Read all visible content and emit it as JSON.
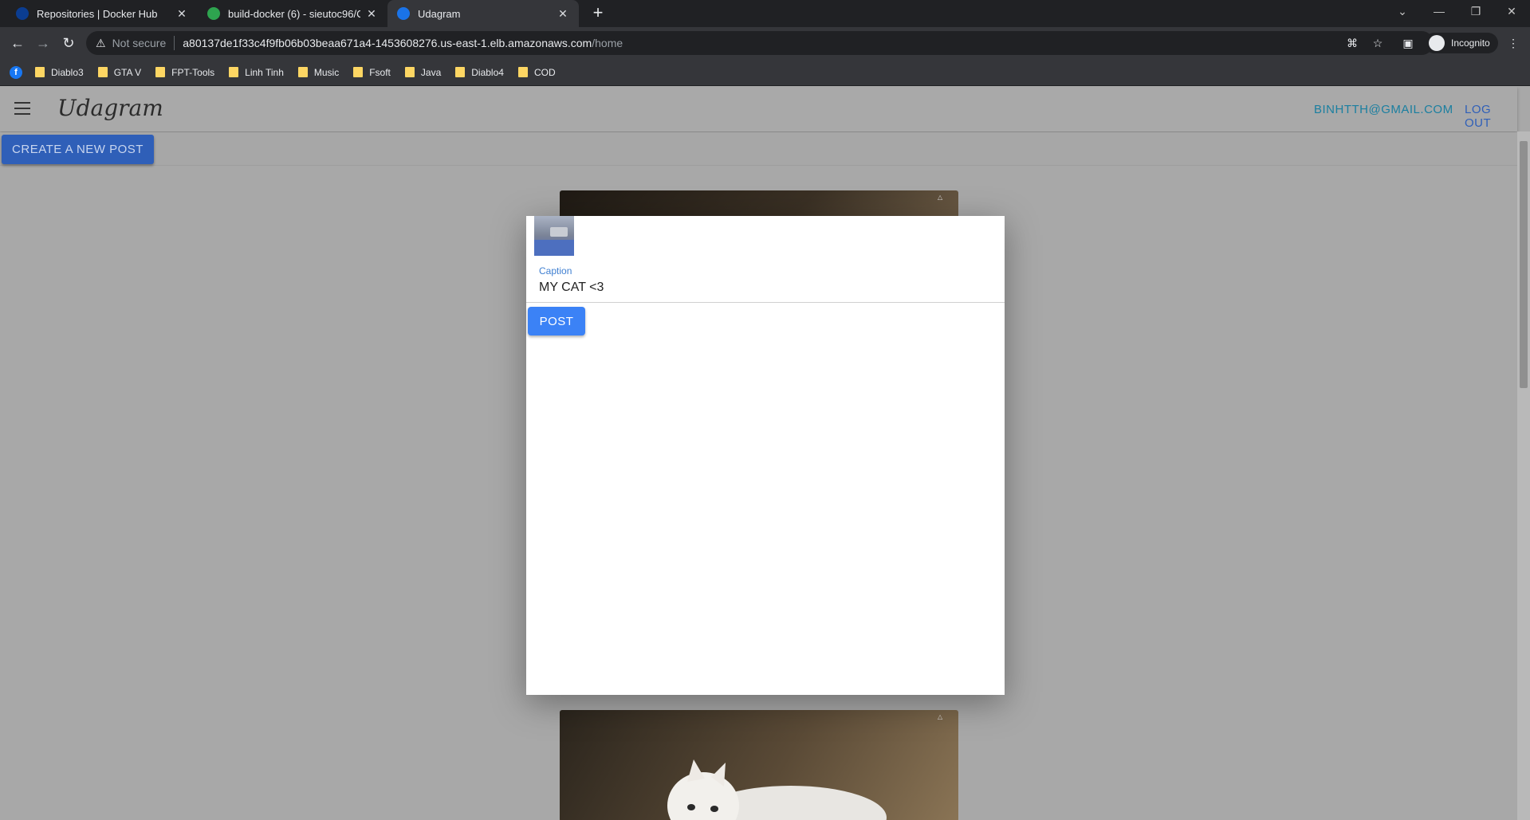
{
  "browser": {
    "tabs": [
      {
        "title": "Repositories | Docker Hub",
        "favicon_color": "#1d63ed"
      },
      {
        "title": "build-docker (6) - sieutoc96/Clo",
        "favicon_color": "#2ea44f"
      },
      {
        "title": "Udagram",
        "favicon_color": "#1a73e8"
      }
    ],
    "address": {
      "security": "Not secure",
      "host": "a80137de1f33c4f9fb06b03beaa671a4-1453608276.us-east-1.elb.amazonaws.com",
      "path": "/home"
    },
    "profile_label": "Incognito",
    "bookmarks": [
      "Diablo3",
      "GTA V",
      "FPT-Tools",
      "Linh Tinh",
      "Music",
      "Fsoft",
      "Java",
      "Diablo4",
      "COD"
    ]
  },
  "app": {
    "logo": "Udagram",
    "user_email": "BINHTTH@GMAIL.COM",
    "logout_label": "LOG OUT",
    "create_post_label": "CREATE A NEW POST",
    "accent_color": "#1a7fa0"
  },
  "modal": {
    "caption_label": "Caption",
    "caption_value": "MY CAT <3",
    "post_label": "POST"
  }
}
